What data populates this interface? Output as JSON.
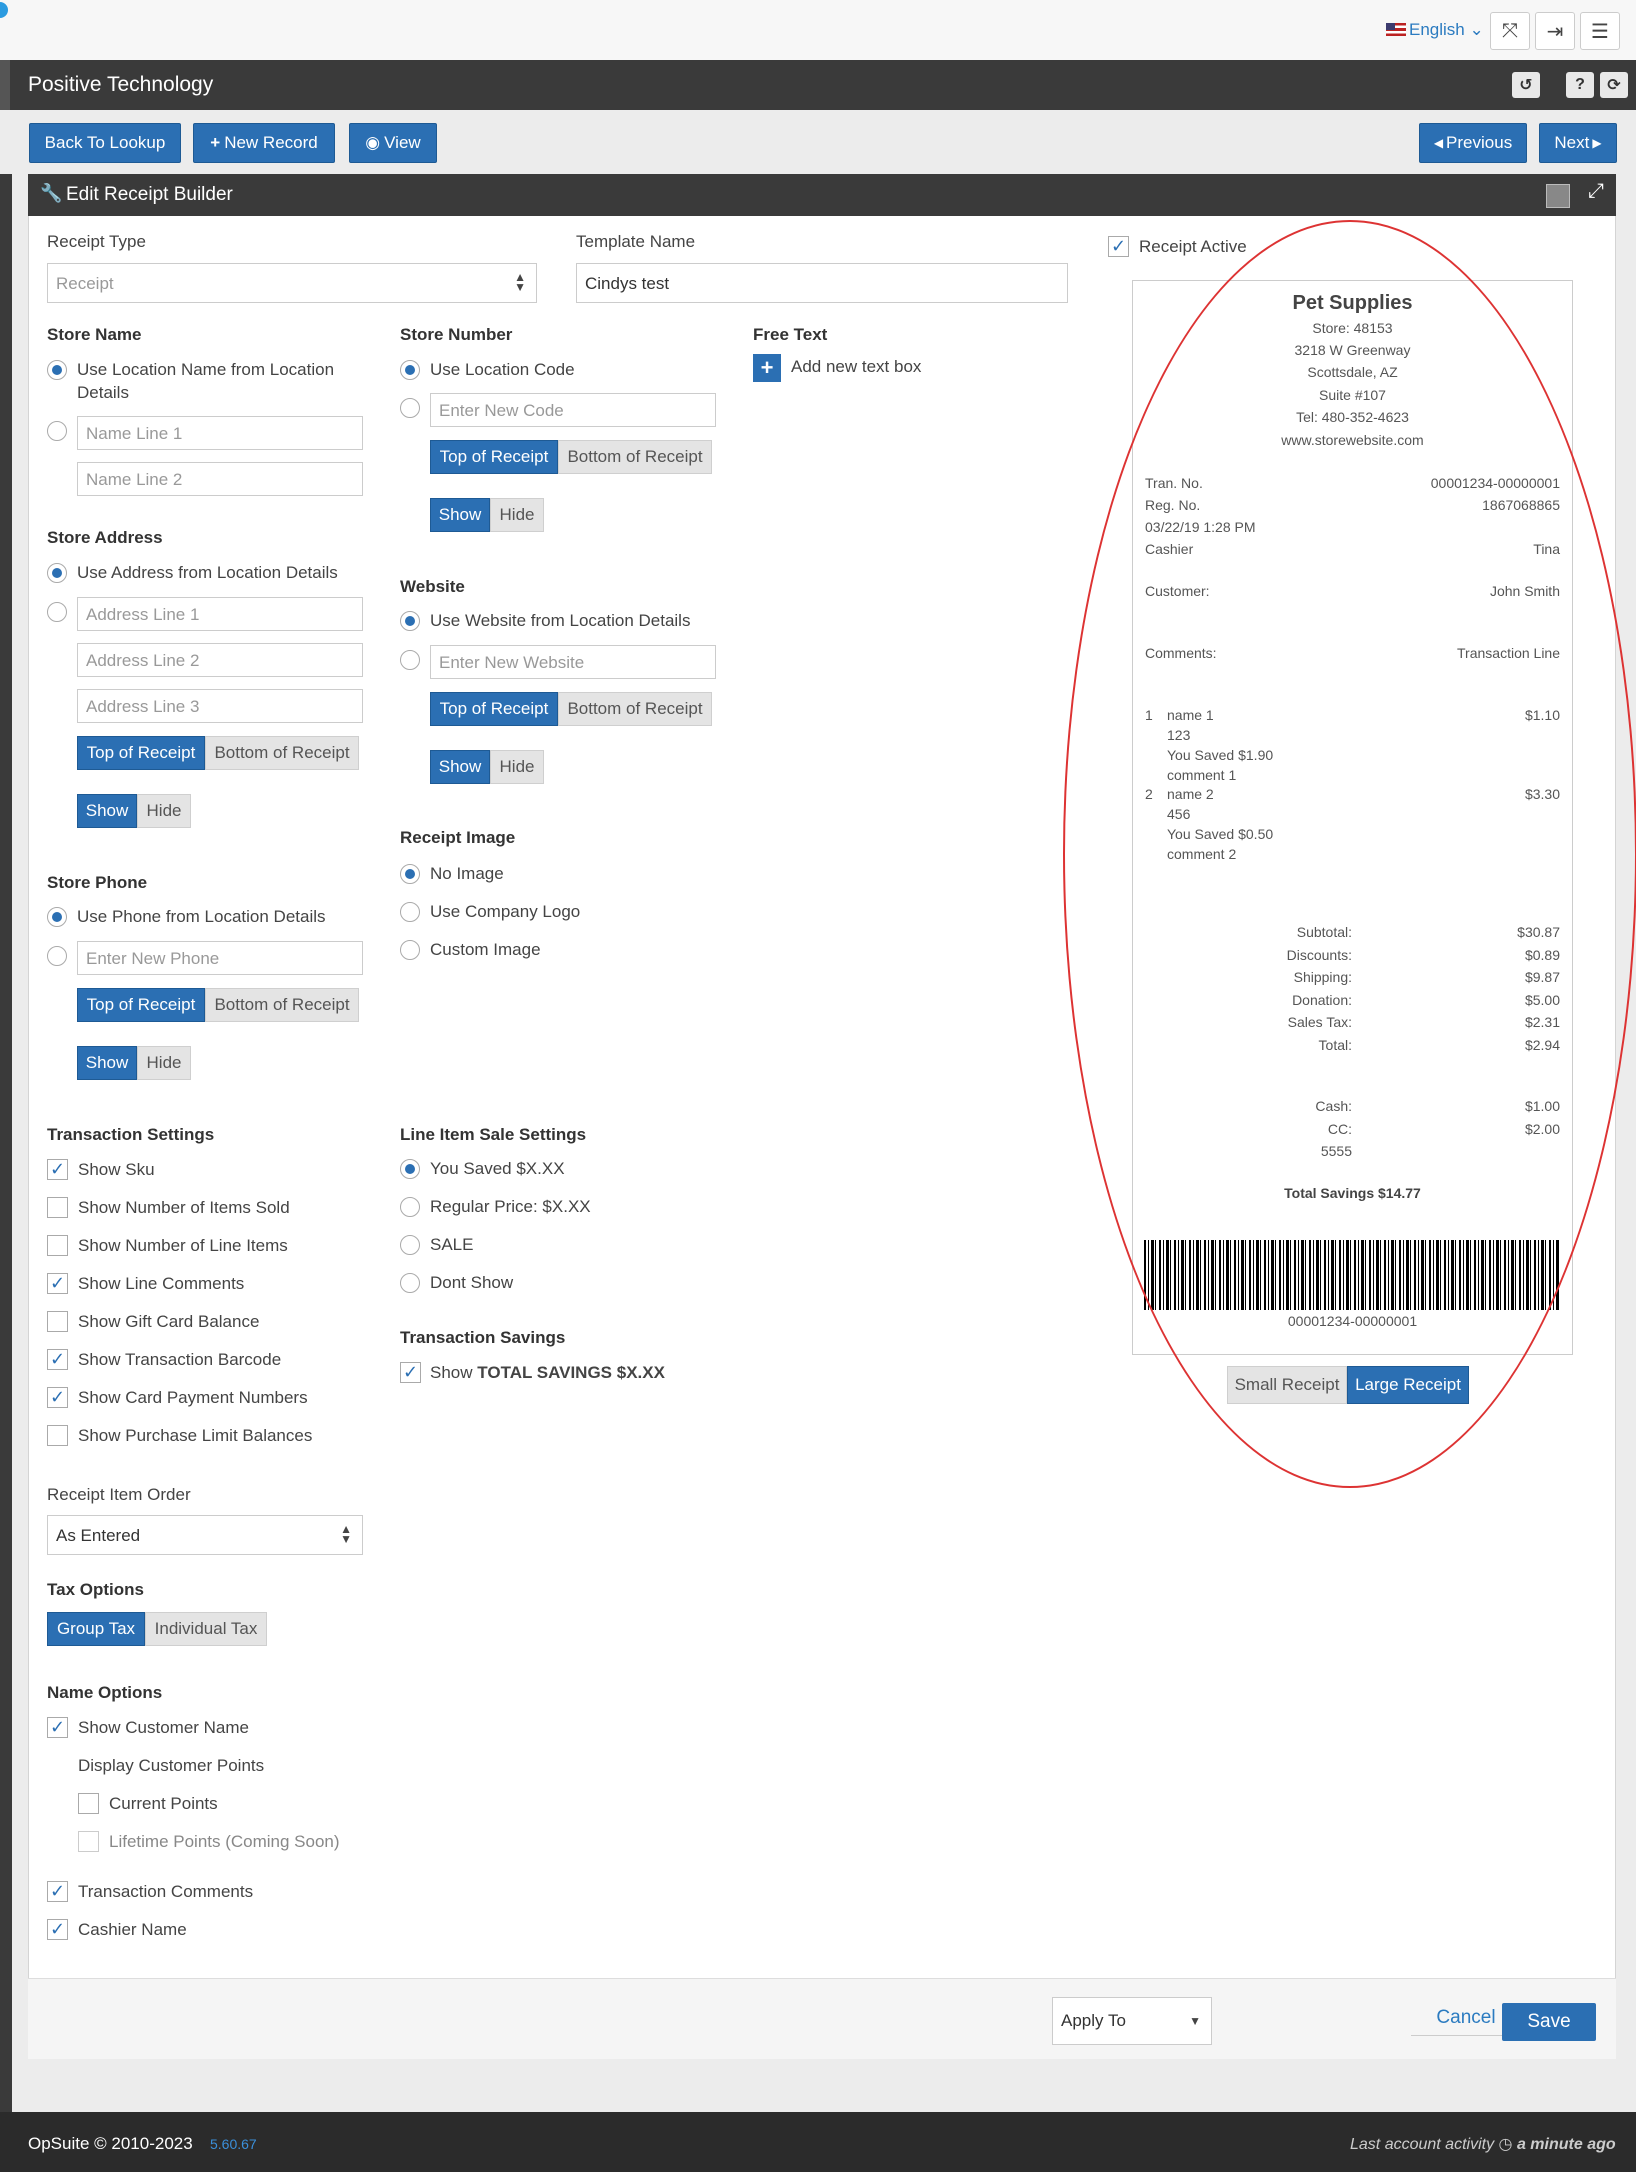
{
  "topbar": {
    "language": "English"
  },
  "app": {
    "title": "Positive Technology"
  },
  "actions": {
    "back": "Back To Lookup",
    "new": "New Record",
    "view": "View",
    "previous": "Previous",
    "next": "Next"
  },
  "panel": {
    "title": "Edit Receipt Builder"
  },
  "form": {
    "receipt_type_label": "Receipt Type",
    "receipt_type_value": "Receipt",
    "template_name_label": "Template Name",
    "template_name_value": "Cindys test",
    "receipt_active": "Receipt Active",
    "store_name": {
      "title": "Store Name",
      "use_location": "Use Location Name from Location",
      "use_location2": "Details",
      "name_line1": "Name Line 1",
      "name_line2": "Name Line 2"
    },
    "store_address": {
      "title": "Store Address",
      "use_location": "Use Address from Location Details",
      "line1": "Address Line 1",
      "line2": "Address Line 2",
      "line3": "Address Line 3"
    },
    "store_phone": {
      "title": "Store Phone",
      "use_location": "Use Phone from Location Details",
      "new_phone": "Enter New Phone"
    },
    "store_number": {
      "title": "Store Number",
      "use_location": "Use Location Code",
      "new_code": "Enter New Code"
    },
    "website": {
      "title": "Website",
      "use_location": "Use Website from Location Details",
      "new_website": "Enter New Website"
    },
    "free_text": {
      "title": "Free Text",
      "add": "Add new text box"
    },
    "receipt_image": {
      "title": "Receipt Image",
      "none": "No Image",
      "company": "Use Company Logo",
      "custom": "Custom Image"
    },
    "seg": {
      "top": "Top of Receipt",
      "bottom": "Bottom of Receipt",
      "show": "Show",
      "hide": "Hide"
    },
    "transaction": {
      "title": "Transaction Settings",
      "items": [
        "Show Sku",
        "Show Number of Items Sold",
        "Show Number of Line Items",
        "Show Line Comments",
        "Show Gift Card Balance",
        "Show Transaction Barcode",
        "Show Card Payment Numbers",
        "Show Purchase Limit Balances"
      ],
      "checked": [
        true,
        false,
        false,
        true,
        false,
        true,
        true,
        false
      ]
    },
    "line_item": {
      "title": "Line Item Sale Settings",
      "options": [
        "You Saved $X.XX",
        "Regular Price: $X.XX",
        "SALE",
        "Dont Show"
      ]
    },
    "savings": {
      "title": "Transaction Savings",
      "show": "Show",
      "bold": "TOTAL SAVINGS $X.XX"
    },
    "item_order": {
      "title": "Receipt Item Order",
      "value": "As Entered"
    },
    "tax": {
      "title": "Tax Options",
      "group": "Group Tax",
      "individual": "Individual Tax"
    },
    "name_options": {
      "title": "Name Options",
      "customer": "Show Customer Name",
      "points": "Display Customer Points",
      "current": "Current Points",
      "lifetime": "Lifetime Points (Coming Soon)",
      "comments": "Transaction Comments",
      "cashier": "Cashier Name"
    }
  },
  "receipt": {
    "store": "Pet Supplies",
    "store_no": "Store: 48153",
    "addr1": "3218 W Greenway",
    "addr2": "Scottsdale, AZ",
    "addr3": "Suite #107",
    "tel": "Tel: 480-352-4623",
    "web": "www.storewebsite.com",
    "tran_label": "Tran. No.",
    "tran_val": "00001234-00000001",
    "reg_label": "Reg. No.",
    "reg_val": "1867068865",
    "date": "03/22/19 1:28 PM",
    "cashier_label": "Cashier",
    "cashier_val": "Tina",
    "customer_label": "Customer:",
    "customer_val": "John Smith",
    "comments_label": "Comments:",
    "comments_val": "Transaction Line",
    "items": [
      {
        "n": "1",
        "name": "name 1",
        "sku": "123",
        "saved": "You Saved $1.90",
        "comment": "comment 1",
        "price": "$1.10"
      },
      {
        "n": "2",
        "name": "name 2",
        "sku": "456",
        "saved": "You Saved $0.50",
        "comment": "comment 2",
        "price": "$3.30"
      }
    ],
    "totals": [
      [
        "Subtotal:",
        "$30.87"
      ],
      [
        "Discounts:",
        "$0.89"
      ],
      [
        "Shipping:",
        "$9.87"
      ],
      [
        "Donation:",
        "$5.00"
      ],
      [
        "Sales Tax:",
        "$2.31"
      ],
      [
        "Total:",
        "$2.94"
      ]
    ],
    "payments": [
      [
        "Cash:",
        "$1.00"
      ],
      [
        "CC:",
        "$2.00"
      ],
      [
        "5555",
        ""
      ]
    ],
    "total_savings": "Total Savings $14.77",
    "barcode_text": "00001234-00000001",
    "small": "Small Receipt",
    "large": "Large Receipt"
  },
  "footer": {
    "apply_to": "Apply To",
    "cancel": "Cancel",
    "save": "Save"
  },
  "bottom": {
    "copyright": "OpSuite © 2010-2023",
    "version": "5.60.67",
    "activity": "Last account activity",
    "ago": "a minute ago"
  }
}
